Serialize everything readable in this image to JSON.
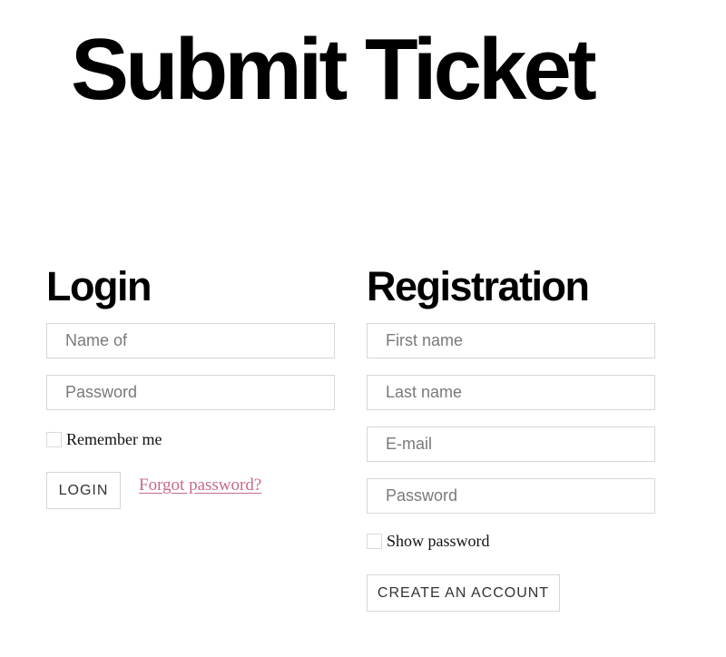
{
  "page": {
    "title": "Submit Ticket"
  },
  "login": {
    "heading": "Login",
    "username_placeholder": "Name of",
    "username_value": "",
    "password_placeholder": "Password",
    "password_value": "",
    "remember_label": "Remember me",
    "remember_checked": false,
    "submit_label": "LOGIN",
    "forgot_label": "Forgot password?"
  },
  "registration": {
    "heading": "Registration",
    "first_name_placeholder": "First name",
    "last_name_placeholder": "Last name",
    "email_placeholder": "E-mail",
    "password_placeholder": "Password",
    "show_password_label": "Show password",
    "show_password_checked": false,
    "submit_label": "CREATE AN ACCOUNT"
  },
  "colors": {
    "link": "#c86b86",
    "border": "#d6d6d6",
    "placeholder": "#7a7a7a"
  }
}
